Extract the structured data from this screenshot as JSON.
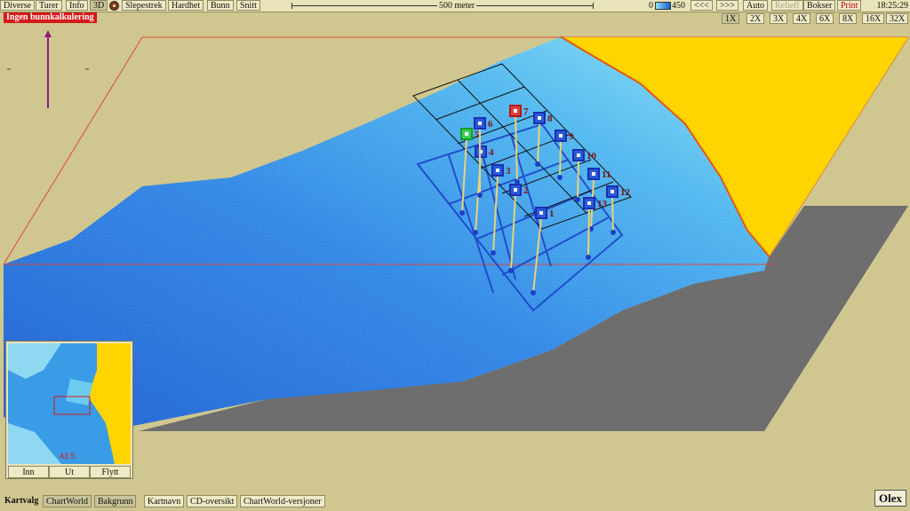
{
  "menu": {
    "items": [
      "Diverse",
      "Turer",
      "Info",
      "3D",
      "Slepestrek",
      "Hardhet",
      "Bunn",
      "Snitt"
    ],
    "scale_label": "500 meter",
    "depth_min": "0",
    "depth_max": "450",
    "nav": [
      "<<<",
      ">>>",
      "Auto",
      "Relieff",
      "Bokser",
      "Print"
    ],
    "time": "18:25:29"
  },
  "zoom": {
    "levels": [
      "1X",
      "2X",
      "3X",
      "4X",
      "6X",
      "8X",
      "16X",
      "32X"
    ],
    "selected": "1X"
  },
  "warning": "Ingen bunnkalkulering",
  "markers": [
    "1",
    "2",
    "3",
    "4",
    "5",
    "6",
    "7",
    "8",
    "9",
    "10",
    "11",
    "12",
    "13"
  ],
  "minimap": {
    "buttons": [
      "Inn",
      "Ut",
      "Flytt"
    ],
    "depth_readout": "43.5"
  },
  "bottom": {
    "label": "Kartvalg",
    "buttons": [
      "ChartWorld",
      "Bakgrunn",
      "Kartnavn",
      "CD-oversikt",
      "ChartWorld-versjoner"
    ]
  },
  "brand": "Olex",
  "colors": {
    "land": "#ffd400",
    "deep_water": "#2f7fe0",
    "shallow_water": "#6fd3ef",
    "rock_wall": "#6f6f6f",
    "background": "#cfc78f"
  }
}
